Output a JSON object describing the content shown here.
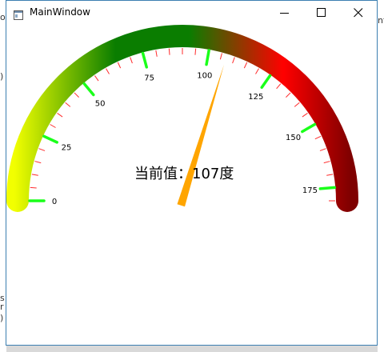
{
  "window": {
    "title": "MainWindow"
  },
  "gauge": {
    "min": 0,
    "max": 180,
    "value": 107,
    "readout_label": "当前值：",
    "readout_unit": "度",
    "major_labels": [
      "0",
      "25",
      "50",
      "75",
      "100",
      "125",
      "150",
      "175"
    ],
    "colors": {
      "band_start": "#f2ff00",
      "band_green": "#0a7d00",
      "band_red": "#ff0000",
      "band_end": "#7f0000",
      "major_tick": "#1aff1a",
      "minor_tick": "#ff2b2b",
      "needle": "#ffa500"
    }
  },
  "background": {
    "left_fragments": [
      "ov",
      ")",
      "s",
      "r",
      ")"
    ],
    "right_fragments": [
      "nf"
    ]
  }
}
